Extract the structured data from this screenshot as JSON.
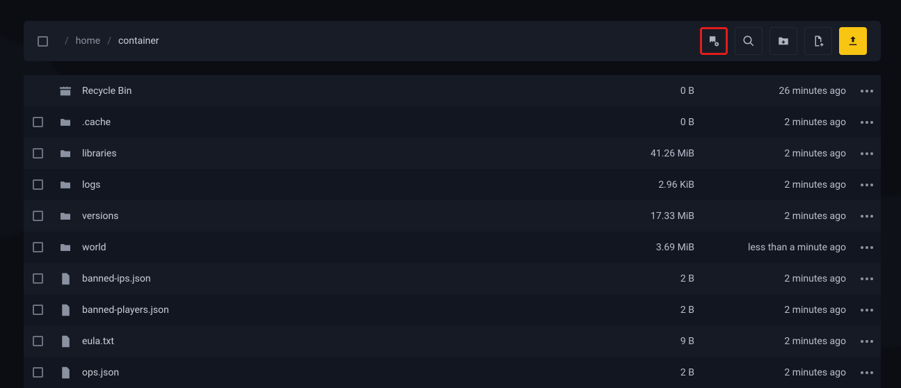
{
  "breadcrumb": {
    "root": "home",
    "current": "container"
  },
  "rows": [
    {
      "kind": "bin",
      "name": "Recycle Bin",
      "size": "0 B",
      "date": "26 minutes ago",
      "check": false
    },
    {
      "kind": "folder",
      "name": ".cache",
      "size": "0 B",
      "date": "2 minutes ago",
      "check": true
    },
    {
      "kind": "folder",
      "name": "libraries",
      "size": "41.26 MiB",
      "date": "2 minutes ago",
      "check": true
    },
    {
      "kind": "folder",
      "name": "logs",
      "size": "2.96 KiB",
      "date": "2 minutes ago",
      "check": true
    },
    {
      "kind": "folder",
      "name": "versions",
      "size": "17.33 MiB",
      "date": "2 minutes ago",
      "check": true
    },
    {
      "kind": "folder",
      "name": "world",
      "size": "3.69 MiB",
      "date": "less than a minute ago",
      "check": true
    },
    {
      "kind": "file",
      "name": "banned-ips.json",
      "size": "2 B",
      "date": "2 minutes ago",
      "check": true
    },
    {
      "kind": "file",
      "name": "banned-players.json",
      "size": "2 B",
      "date": "2 minutes ago",
      "check": true
    },
    {
      "kind": "file",
      "name": "eula.txt",
      "size": "9 B",
      "date": "2 minutes ago",
      "check": true
    },
    {
      "kind": "file",
      "name": "ops.json",
      "size": "2 B",
      "date": "2 minutes ago",
      "check": true
    }
  ]
}
